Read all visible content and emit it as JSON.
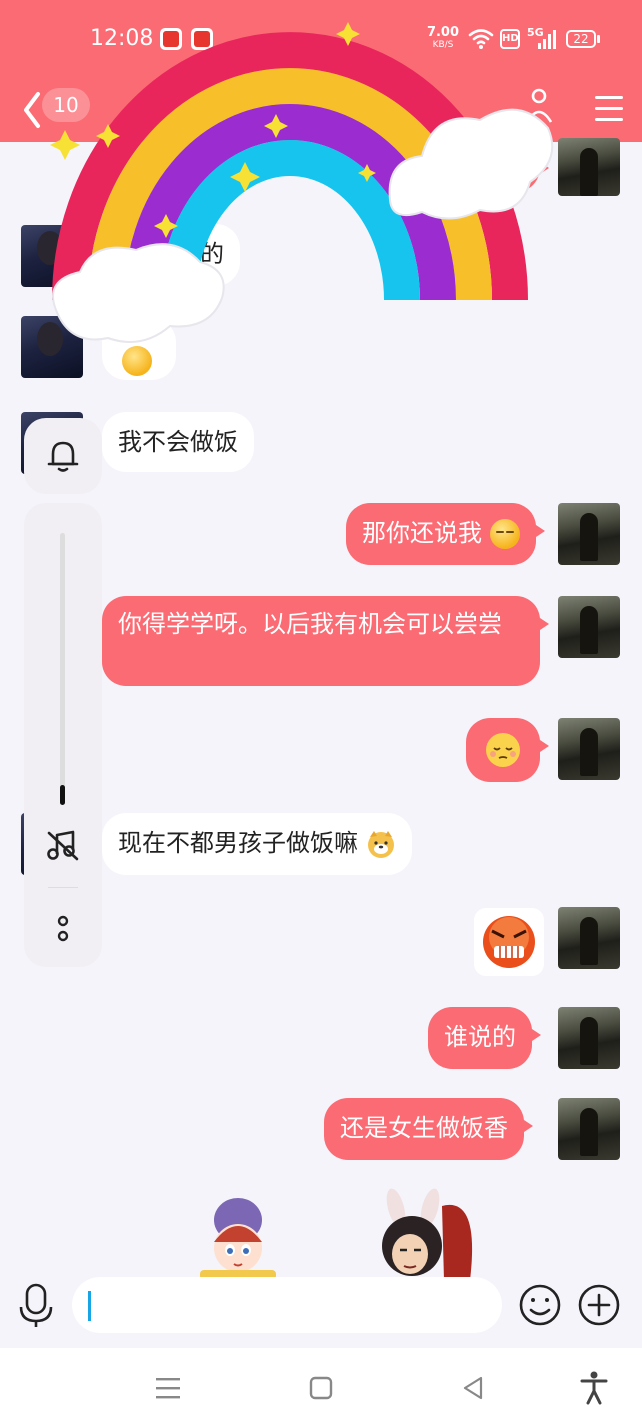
{
  "status_bar": {
    "time": "12:08",
    "net_speed_value": "7.00",
    "net_speed_unit": "KB/S",
    "network": "5G",
    "hd_label": "HD",
    "battery": "22"
  },
  "header": {
    "back_label": "返回",
    "unread_count": "10"
  },
  "side_panel": {
    "bell_label": "通知",
    "music_label": "音乐",
    "more_label": "更多"
  },
  "messages": [
    {
      "side": "left",
      "text": "的"
    },
    {
      "side": "left",
      "text": "我不会做饭"
    },
    {
      "side": "right",
      "text": "那你还说我"
    },
    {
      "side": "right",
      "text": "你得学学呀。以后我有机会可以尝尝"
    },
    {
      "side": "left",
      "text": "现在不都男孩子做饭嘛"
    },
    {
      "side": "right",
      "text": "谁说的"
    },
    {
      "side": "right",
      "text": "还是女生做饭香"
    }
  ],
  "input": {
    "value": ""
  },
  "colors": {
    "accent": "#fb6b74",
    "chat_bg": "#f4f4fa",
    "caret": "#17a5e6"
  },
  "icons": [
    "back-chevron-icon",
    "person-icon",
    "menu-icon",
    "bell-icon",
    "music-off-icon",
    "more-icon",
    "microphone-icon",
    "emoji-icon",
    "plus-icon",
    "recents-icon",
    "home-icon",
    "back-icon",
    "accessibility-icon"
  ]
}
